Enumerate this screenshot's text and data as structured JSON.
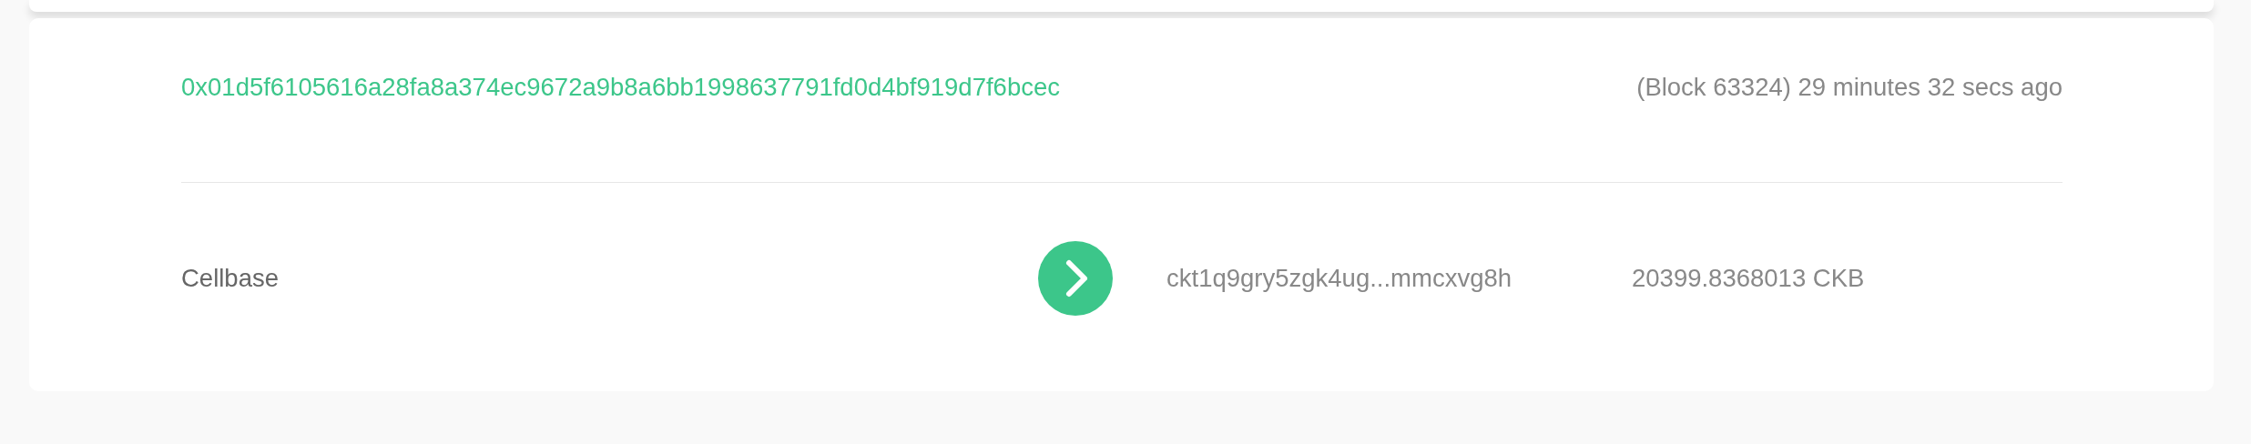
{
  "transaction": {
    "hash": "0x01d5f6105616a28fa8a374ec9672a9b8a6bb1998637791fd0d4bf919d7f6bcec",
    "block_info": "(Block 63324) 29 minutes 32 secs ago"
  },
  "inputs": [
    {
      "label": "Cellbase"
    }
  ],
  "outputs": [
    {
      "address": "ckt1q9gry5zgk4ug...mmcxvg8h",
      "amount": "20399.8368013 CKB"
    }
  ]
}
